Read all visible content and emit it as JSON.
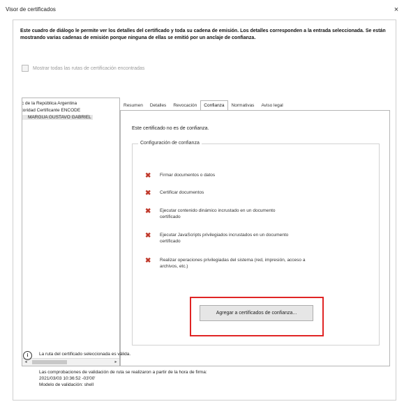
{
  "window": {
    "title": "Visor de certificados",
    "close_glyph": "×"
  },
  "intro": {
    "text": "Este cuadro de diálogo le permite ver los detalles del certificado y toda su cadena de emisión. Los detalles corresponden a la entrada seleccionada. Se están mostrando varias cadenas de emisión porque ninguna de ellas se emitió por un anclaje de confianza."
  },
  "checkbox": {
    "label": "Mostrar todas las rutas de certificación encontradas",
    "checked": false,
    "enabled": false
  },
  "tree": {
    "items": [
      "c de la República Argentina",
      "toridad Certificante ENCODE",
      "MARGUA GUSTAVO GABRIEL"
    ],
    "selected_index": 2
  },
  "tabs": [
    "Resumen",
    "Detalles",
    "Revocación",
    "Confianza",
    "Normativas",
    "Aviso legal"
  ],
  "active_tab_index": 3,
  "panel": {
    "status": "Este certificado no es de confianza.",
    "group_title": "Configuración de confianza",
    "permissions": [
      {
        "icon": "red-x-icon",
        "label": "Firmar documentos o datos"
      },
      {
        "icon": "red-x-icon",
        "label": "Certificar documentos"
      },
      {
        "icon": "red-x-icon",
        "label": "Ejecutar contenido dinámico incrustado en un documento certificado"
      },
      {
        "icon": "red-x-icon",
        "label": "Ejecutar JavaScripts privilegiados incrustados en un documento certificado"
      },
      {
        "icon": "red-x-icon",
        "label": "Realizar operaciones privilegiadas del sistema (red, impresión, acceso a archivos, etc.)"
      }
    ],
    "button_label": "Agregar a certificados de confianza..."
  },
  "footer": {
    "icon": "info-icon",
    "status": "La ruta del certificado seleccionada es válida.",
    "line1": "Las comprobaciones de validación de ruta se realizaron a partir de la hora de firma:",
    "line2": "2021/03/03 10:36:52 -03'00'",
    "line3": "Modelo de validación: shell"
  },
  "colors": {
    "error_red": "#c0392b",
    "highlight_red": "#e02424"
  }
}
